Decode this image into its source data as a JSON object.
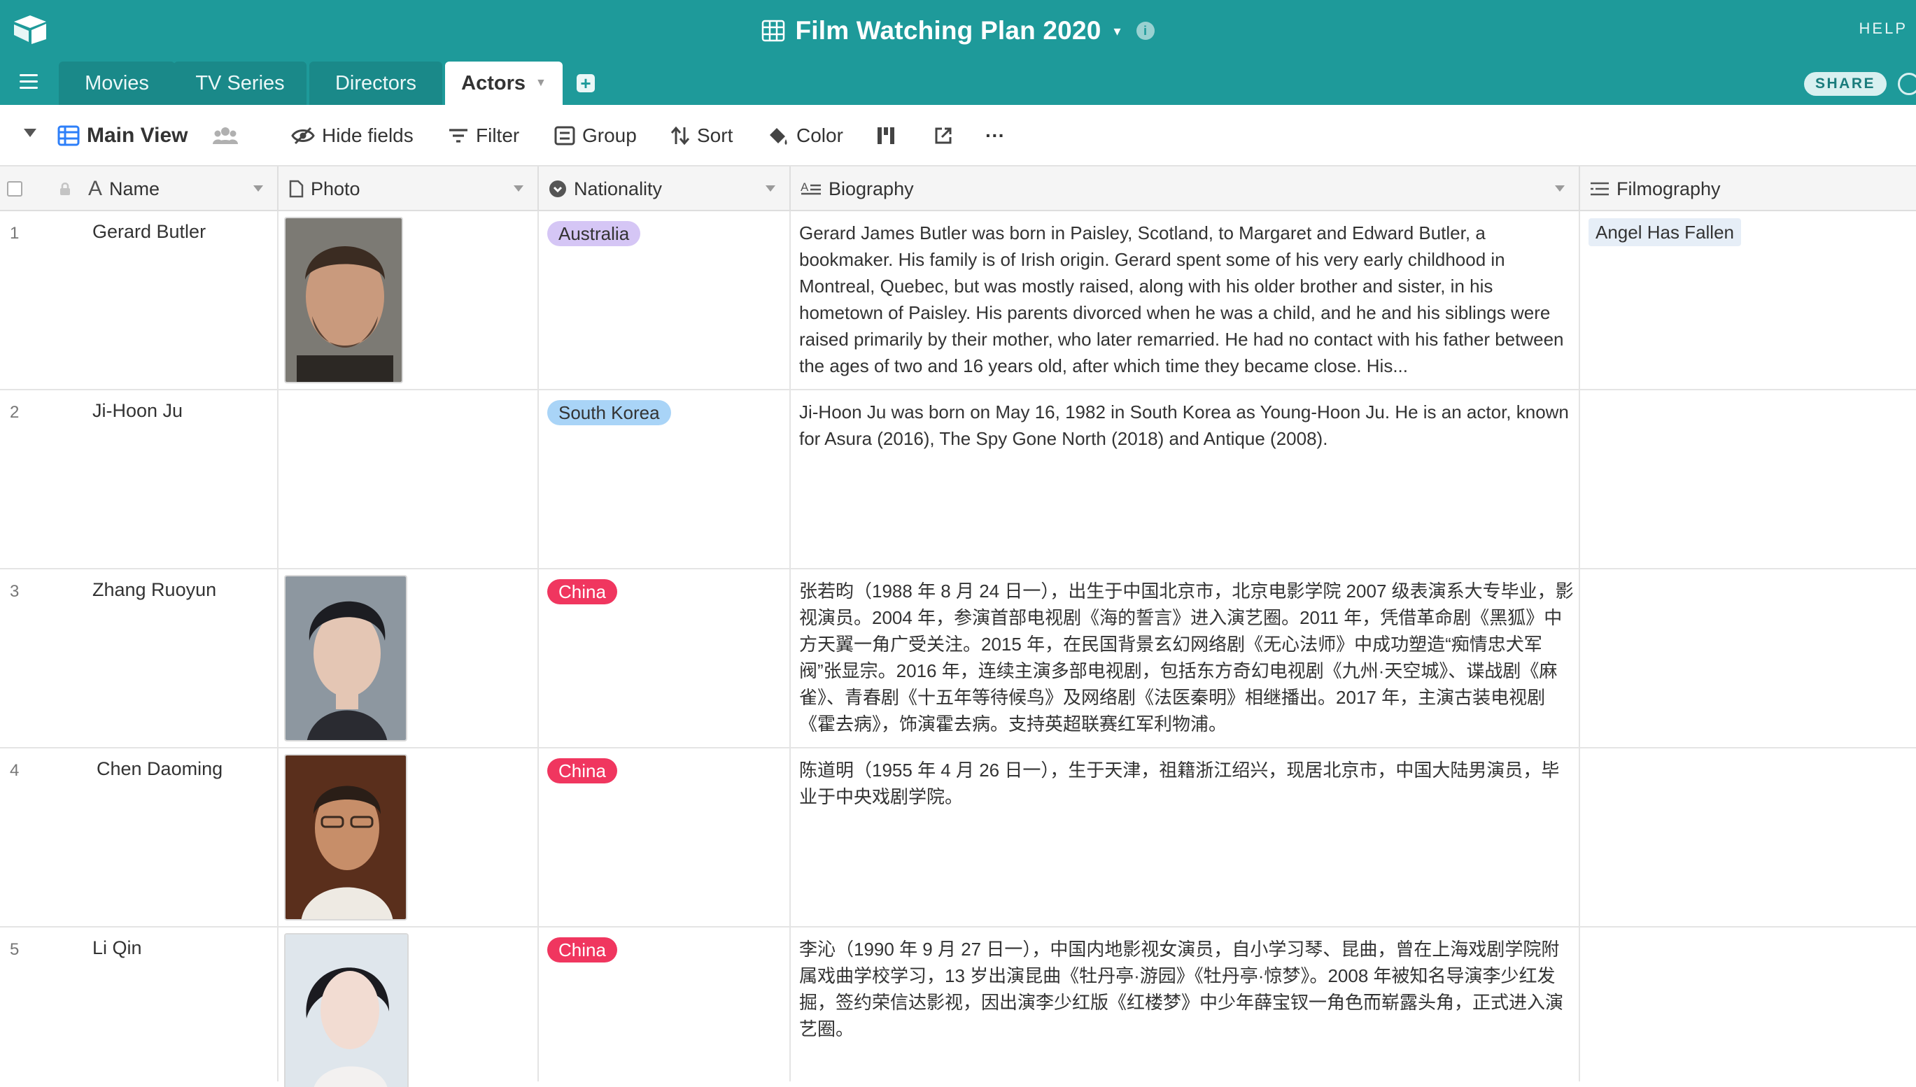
{
  "app": {
    "title": "Film Watching Plan 2020",
    "help": "HELP",
    "share": "SHARE",
    "colors": {
      "brand": "#1e9a9a",
      "tab_inactive": "#1a8989"
    }
  },
  "tabs": [
    {
      "label": "Movies"
    },
    {
      "label": "TV Series"
    },
    {
      "label": "Directors"
    },
    {
      "label": "Actors",
      "active": true
    }
  ],
  "toolbar": {
    "view_name": "Main View",
    "hide_fields": "Hide fields",
    "filter": "Filter",
    "group": "Group",
    "sort": "Sort",
    "color": "Color",
    "more": "···"
  },
  "columns": {
    "name": "Name",
    "photo": "Photo",
    "nationality": "Nationality",
    "biography": "Biography",
    "filmography": "Filmography"
  },
  "rows": [
    {
      "num": "1",
      "name": "Gerard Butler",
      "nationality": "Australia",
      "nationality_color": "#d5c6f5",
      "biography": "Gerard James Butler was born in Paisley, Scotland, to Margaret and Edward Butler, a bookmaker. His family is of Irish origin. Gerard spent some of his very early childhood in Montreal, Quebec, but was mostly raised, along with his older brother and sister, in his hometown of Paisley. His parents divorced when he was a child, and he and his siblings were raised primarily by their mother, who later remarried. He had no contact with his father between the ages of two and 16 years old, after which time they became close. His...",
      "filmography": "Angel Has Fallen"
    },
    {
      "num": "2",
      "name": "Ji-Hoon Ju",
      "nationality": "South Korea",
      "nationality_color": "#a9d4f7",
      "biography": "Ji-Hoon Ju was born on May 16, 1982 in South Korea as Young-Hoon Ju. He is an actor, known for Asura (2016), The Spy Gone North (2018) and Antique (2008).",
      "filmography": ""
    },
    {
      "num": "3",
      "name": "Zhang Ruoyun",
      "nationality": "China",
      "nationality_color": "#f0365f",
      "biography": "张若昀（1988 年 8 月 24 日一），出生于中国北京市，北京电影学院 2007 级表演系大专毕业，影视演员。2004 年，参演首部电视剧《海的誓言》进入演艺圈。2011 年，凭借革命剧《黑狐》中方天翼一角广受关注。2015 年，在民国背景玄幻网络剧《无心法师》中成功塑造“痴情忠犬军阀”张显宗。2016 年，连续主演多部电视剧，包括东方奇幻电视剧《九州·天空城》、谍战剧《麻雀》、青春剧《十五年等待候鸟》及网络剧《法医秦明》相继播出。2017 年，主演古装电视剧《霍去病》，饰演霍去病。支持英超联赛红军利物浦。",
      "filmography": ""
    },
    {
      "num": "4",
      "name": "Chen Daoming",
      "nationality": "China",
      "nationality_color": "#f0365f",
      "biography": "陈道明（1955 年 4 月 26 日一），生于天津，祖籍浙江绍兴，现居北京市，中国大陆男演员，毕业于中央戏剧学院。",
      "filmography": ""
    },
    {
      "num": "5",
      "name": "Li Qin",
      "nationality": "China",
      "nationality_color": "#f0365f",
      "biography": "李沁（1990 年 9 月 27 日一），中国内地影视女演员，自小学习琴、昆曲，曾在上海戏剧学院附属戏曲学校学习，13 岁出演昆曲《牡丹亭·游园》《牡丹亭·惊梦》。2008 年被知名导演李少红发掘，签约荣信达影视，因出演李少红版《红楼梦》中少年薛宝钗一角色而崭露头角，正式进入演艺圈。",
      "filmography": ""
    }
  ]
}
